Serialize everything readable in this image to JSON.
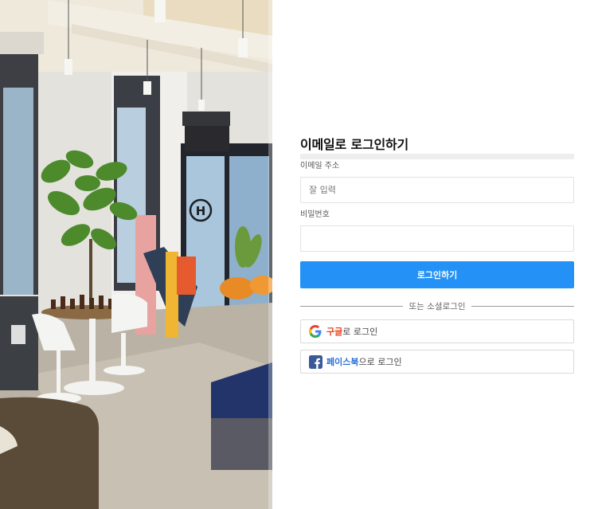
{
  "login": {
    "title": "이메일로 로그인하기",
    "email_label": "이메일 주소",
    "email_placeholder": "잘 입력",
    "email_value": "",
    "password_label": "비밀번호",
    "password_value": "",
    "submit_label": "로그인하기",
    "divider_text": "또는 소셜로그인",
    "google": {
      "brand": "구글",
      "suffix": "로 로그인",
      "icon": "google-g-icon"
    },
    "facebook": {
      "brand": "페이스북",
      "suffix": "으로 로그인",
      "icon": "facebook-f-icon"
    }
  },
  "colors": {
    "primary": "#2391f5",
    "google_text": "#e8431f",
    "facebook_text": "#2a6fdb",
    "facebook_icon": "#3b5998"
  }
}
